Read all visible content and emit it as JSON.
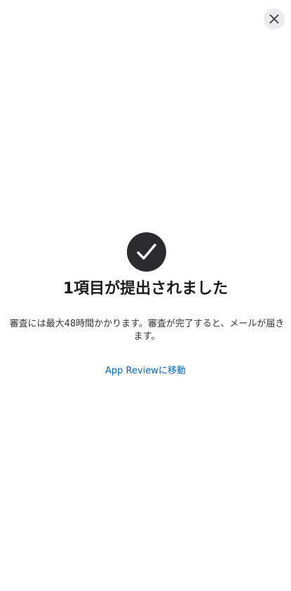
{
  "dialog": {
    "close_icon": "close-icon",
    "status_icon": "checkmark-circle-icon",
    "title": "1項目が提出されました",
    "message": "審査には最大48時間かかります。審査が完了すると、メールが届きます。",
    "link_label": "App Reviewに移動"
  },
  "colors": {
    "close_bg": "#ececee",
    "badge_bg": "#2c2c2e",
    "link": "#0066cc"
  }
}
